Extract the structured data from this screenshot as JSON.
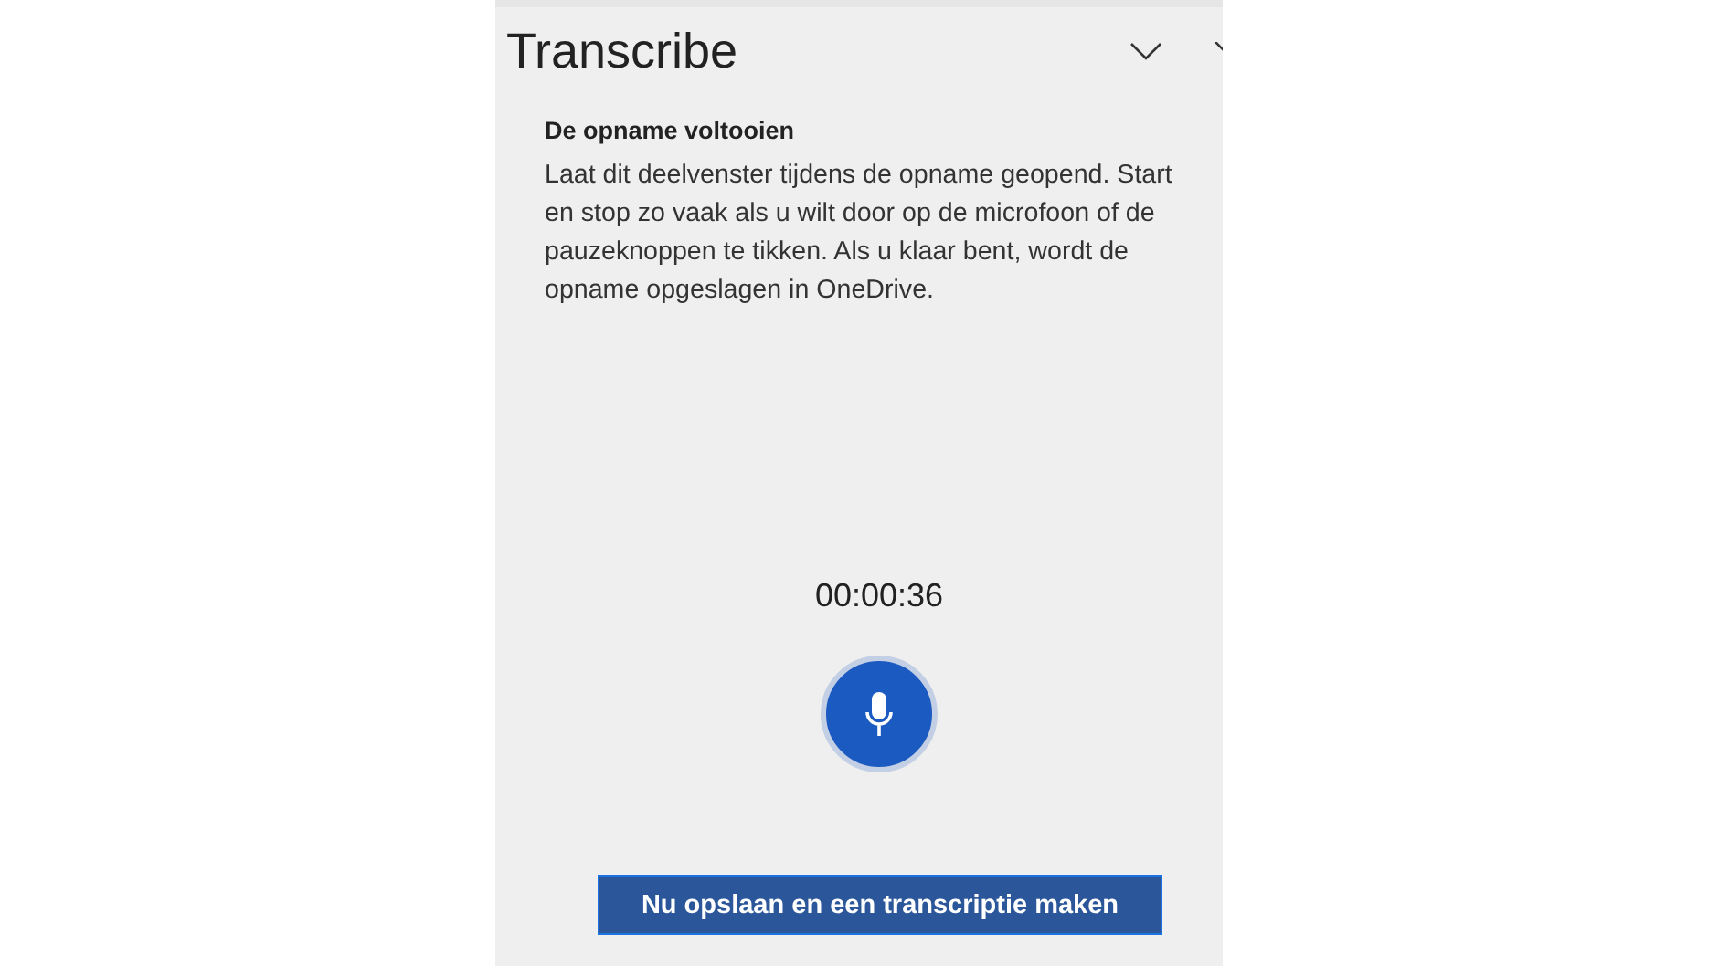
{
  "pane": {
    "title": "Transcribe"
  },
  "section": {
    "heading": "De opname voltooien",
    "description": "Laat dit deelvenster tijdens de opname geopend. Start en stop zo vaak als u wilt door op de microfoon of de pauzeknoppen te tikken. Als u klaar bent, wordt de opname opgeslagen in OneDrive."
  },
  "recorder": {
    "elapsed": "00:00:36"
  },
  "save_button": {
    "label": "Nu opslaan en een transcriptie maken"
  }
}
